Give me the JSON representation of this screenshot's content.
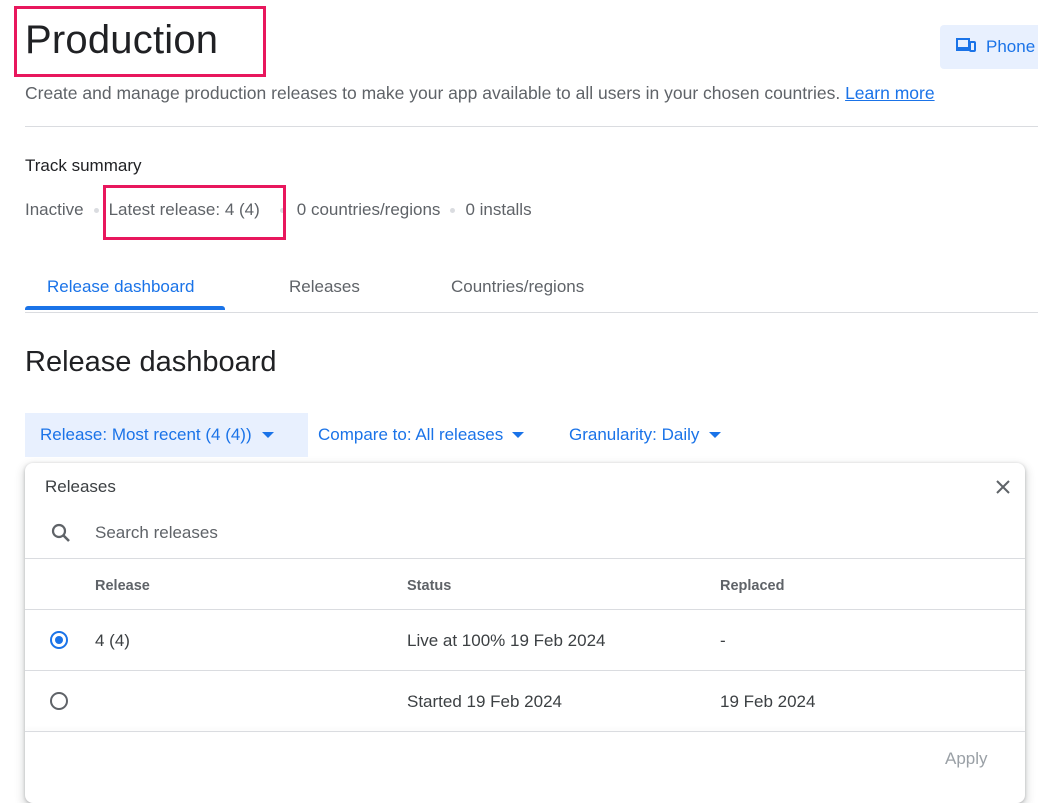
{
  "header": {
    "title": "Production",
    "device_button": "Phone",
    "subtitle": "Create and manage production releases to make your app available to all users in your chosen countries.",
    "learn_more": "Learn more"
  },
  "track_summary": {
    "heading": "Track summary",
    "status": "Inactive",
    "latest_release": "Latest release: 4 (4)",
    "countries": "0 countries/regions",
    "installs": "0 installs"
  },
  "tabs": [
    {
      "label": "Release dashboard",
      "active": true
    },
    {
      "label": "Releases",
      "active": false
    },
    {
      "label": "Countries/regions",
      "active": false
    }
  ],
  "dashboard": {
    "heading": "Release dashboard",
    "filters": {
      "release": "Release: Most recent (4 (4))",
      "compare": "Compare to: All releases",
      "granularity": "Granularity: Daily"
    }
  },
  "releases_panel": {
    "title": "Releases",
    "search_placeholder": "Search releases",
    "columns": [
      "Release",
      "Status",
      "Replaced"
    ],
    "rows": [
      {
        "release": "4 (4)",
        "status": "Live at 100% 19 Feb 2024",
        "replaced": "-",
        "selected": true
      },
      {
        "release": "",
        "status": "Started 19 Feb 2024",
        "replaced": "19 Feb 2024",
        "selected": false
      }
    ],
    "apply_label": "Apply"
  },
  "colors": {
    "accent": "#1a73e8",
    "highlight_border": "#e8175d",
    "chip_bg": "#e8f0fe"
  }
}
